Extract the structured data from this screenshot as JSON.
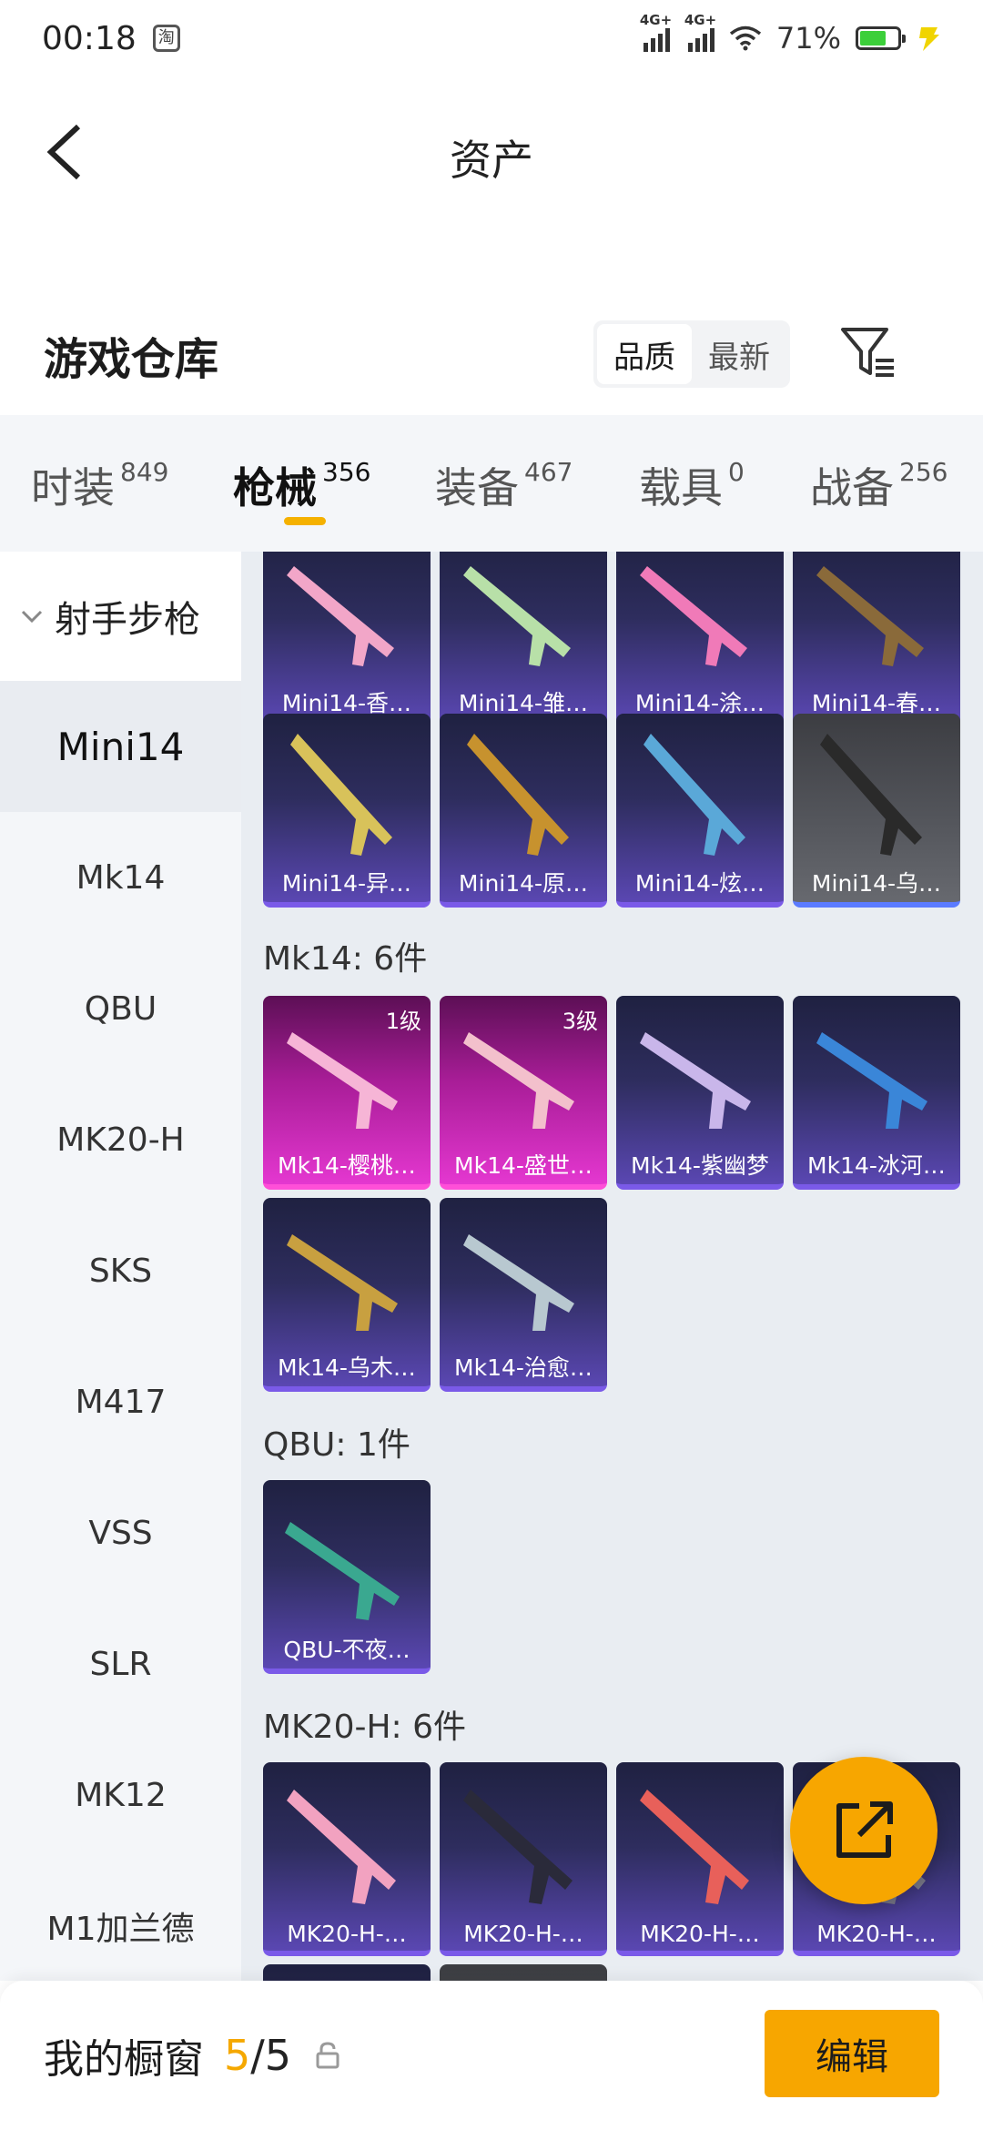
{
  "status_bar": {
    "time": "00:18",
    "app_icon_glyph": "淘",
    "network_1": "4G+",
    "network_2": "4G+",
    "battery_percent": "71%",
    "battery_level": 0.71
  },
  "header": {
    "title": "资产",
    "back_icon": "chevron-left-icon"
  },
  "warehouse": {
    "title": "游戏仓库",
    "sort_options": [
      "品质",
      "最新"
    ],
    "active_sort": "品质",
    "filter_icon": "filter-icon"
  },
  "tabs": [
    {
      "label": "时装",
      "count": "849"
    },
    {
      "label": "枪械",
      "count": "356"
    },
    {
      "label": "装备",
      "count": "467"
    },
    {
      "label": "载具",
      "count": "0"
    },
    {
      "label": "战备",
      "count": "256"
    }
  ],
  "active_tab": "枪械",
  "sidebar": {
    "group": "射手步枪",
    "items": [
      "Mini14",
      "Mk14",
      "QBU",
      "MK20-H",
      "SKS",
      "M417",
      "VSS",
      "SLR",
      "MK12",
      "M1加兰德"
    ],
    "active": "Mini14"
  },
  "sections": {
    "mini14_row1": [
      "Mini14-香…",
      "Mini14-雏…",
      "Mini14-涂…",
      "Mini14-春…"
    ],
    "mini14_row2": [
      "Mini14-异…",
      "Mini14-原…",
      "Mini14-炫…",
      "Mini14-乌…"
    ],
    "mk14_title": "Mk14: 6件",
    "mk14_row1": [
      "Mk14-樱桃…",
      "Mk14-盛世…",
      "Mk14-紫幽梦",
      "Mk14-冰河…"
    ],
    "mk14_levels": [
      "1级",
      "3级"
    ],
    "mk14_row2": [
      "Mk14-乌木…",
      "Mk14-治愈…"
    ],
    "qbu_title": "QBU: 1件",
    "qbu_row1": [
      "QBU-不夜…"
    ],
    "mk20_title": "MK20-H: 6件",
    "mk20_row1": [
      "MK20-H-…",
      "MK20-H-…",
      "MK20-H-…",
      "MK20-H-…"
    ]
  },
  "share_icon": "share-icon",
  "bottom_bar": {
    "label": "我的橱窗",
    "current": "5",
    "separator": "/",
    "total": "5",
    "lock_icon": "lock-icon",
    "edit_label": "编辑"
  },
  "colors": {
    "accent": "#f7a600",
    "card_purple": "#5a47b2",
    "card_pink": "#e437d0",
    "card_gray": "#55575d"
  }
}
